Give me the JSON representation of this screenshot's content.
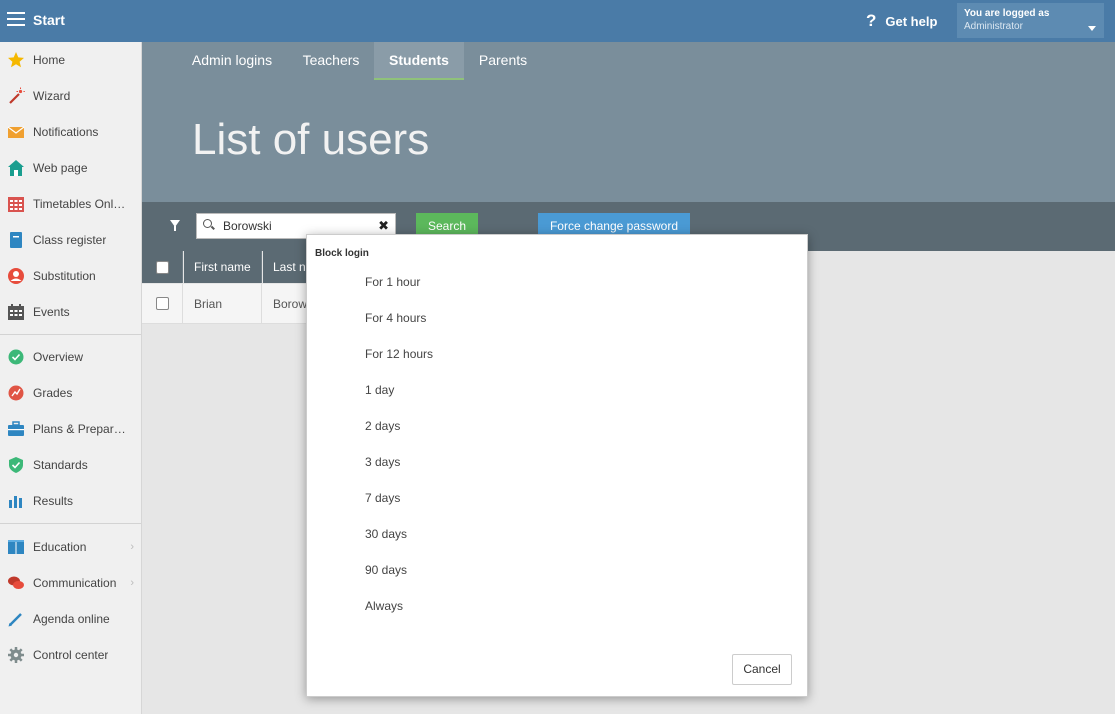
{
  "topbar": {
    "start_label": "Start",
    "help_label": "Get help",
    "logged_line1": "You are logged as",
    "logged_line2": "Administrator"
  },
  "sidebar": {
    "items": [
      {
        "label": "Home",
        "icon": "star-icon"
      },
      {
        "label": "Wizard",
        "icon": "magic-wand-icon"
      },
      {
        "label": "Notifications",
        "icon": "envelope-icon"
      },
      {
        "label": "Web page",
        "icon": "house-icon"
      },
      {
        "label": "Timetables Onl…",
        "icon": "calendar-grid-icon"
      },
      {
        "label": "Class register",
        "icon": "book-icon"
      },
      {
        "label": "Substitution",
        "icon": "person-icon"
      },
      {
        "label": "Events",
        "icon": "calendar-icon"
      },
      {
        "label": "Overview",
        "icon": "check-circle-icon"
      },
      {
        "label": "Grades",
        "icon": "grades-circle-icon"
      },
      {
        "label": "Plans & Prepar…",
        "icon": "briefcase-icon"
      },
      {
        "label": "Standards",
        "icon": "shield-icon"
      },
      {
        "label": "Results",
        "icon": "bar-chart-icon"
      },
      {
        "label": "Education",
        "icon": "education-book-icon"
      },
      {
        "label": "Communication",
        "icon": "chat-bubbles-icon"
      },
      {
        "label": "Agenda online",
        "icon": "pencil-icon"
      },
      {
        "label": "Control center",
        "icon": "gear-icon"
      }
    ]
  },
  "header": {
    "tabs": [
      "Admin logins",
      "Teachers",
      "Students",
      "Parents"
    ],
    "active_tab": "Students",
    "title": "List of users"
  },
  "filter": {
    "search_value": "Borowski",
    "search_button": "Search",
    "force_button": "Force change password"
  },
  "table": {
    "headers": [
      "First name",
      "Last n"
    ],
    "rows": [
      {
        "first": "Brian",
        "last": "Borow"
      }
    ]
  },
  "modal": {
    "title": "Block login",
    "options": [
      "For 1 hour",
      "For 4 hours",
      "For 12 hours",
      "1 day",
      "2 days",
      "3 days",
      "7 days",
      "30 days",
      "90 days",
      "Always"
    ],
    "cancel": "Cancel"
  },
  "colors": {
    "topbar": "#4a7ba7",
    "header": "#7a8e9b",
    "filterbar": "#5b6a73",
    "search_button": "#5cb85c",
    "force_button": "#4a9ad4",
    "active_tab_underline": "#8fc27a"
  }
}
